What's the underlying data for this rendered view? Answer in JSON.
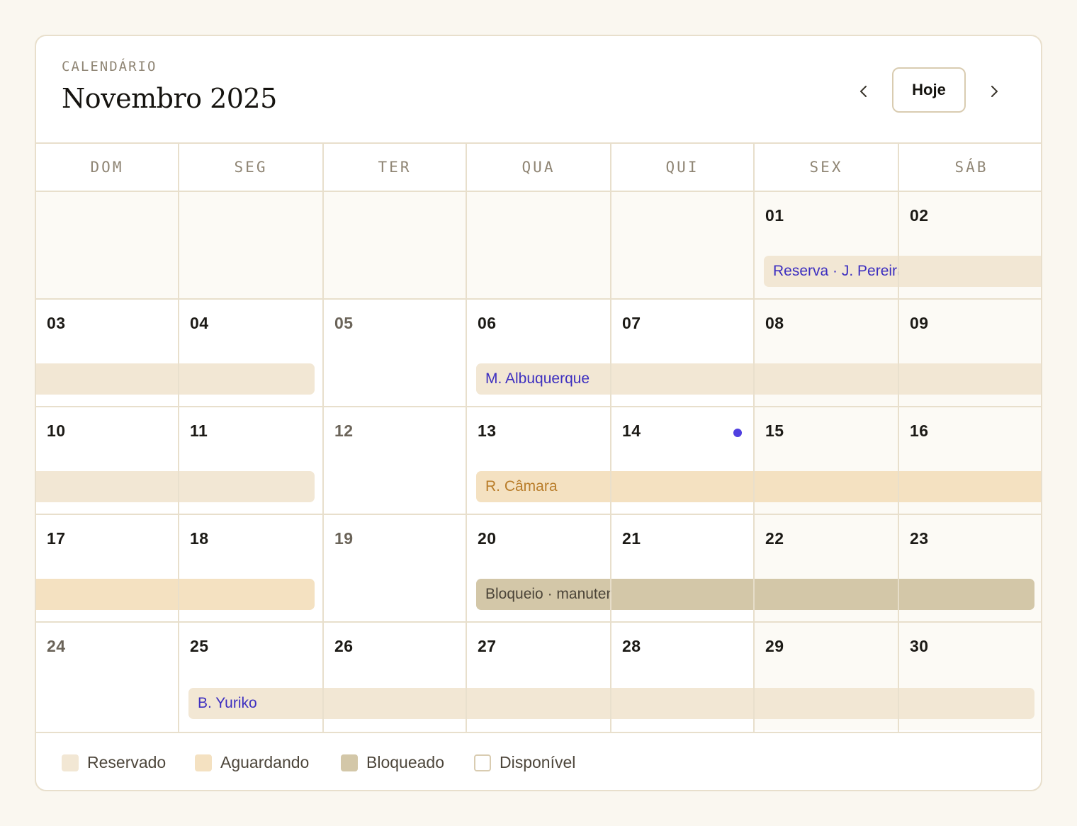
{
  "header": {
    "eyebrow": "CALENDÁRIO",
    "title": "Novembro 2025",
    "today_label": "Hoje",
    "prev_icon": "chevron-left-icon",
    "next_icon": "chevron-right-icon"
  },
  "weekdays": [
    "DOM",
    "SEG",
    "TER",
    "QUA",
    "QUI",
    "SEX",
    "SÁB"
  ],
  "weeks": [
    [
      "",
      "",
      "",
      "",
      "",
      "01",
      "02"
    ],
    [
      "03",
      "04",
      "05",
      "06",
      "07",
      "08",
      "09"
    ],
    [
      "10",
      "11",
      "12",
      "13",
      "14",
      "15",
      "16"
    ],
    [
      "17",
      "18",
      "19",
      "20",
      "21",
      "22",
      "23"
    ],
    [
      "24",
      "25",
      "26",
      "27",
      "28",
      "29",
      "30"
    ]
  ],
  "events": {
    "e1": "Reserva · J. Pereira",
    "e3": "M. Albuquerque",
    "e5": "R. Câmara",
    "e7": "Bloqueio · manutenção",
    "e8": "B. Yuriko"
  },
  "legend": {
    "reserved": "Reservado",
    "pending": "Aguardando",
    "blocked": "Bloqueado",
    "available": "Disponível"
  },
  "colors": {
    "reserved": "#f2e7d4",
    "pending": "#f4e1c1",
    "blocked": "#d3c7a8",
    "accent": "#5040e0"
  }
}
